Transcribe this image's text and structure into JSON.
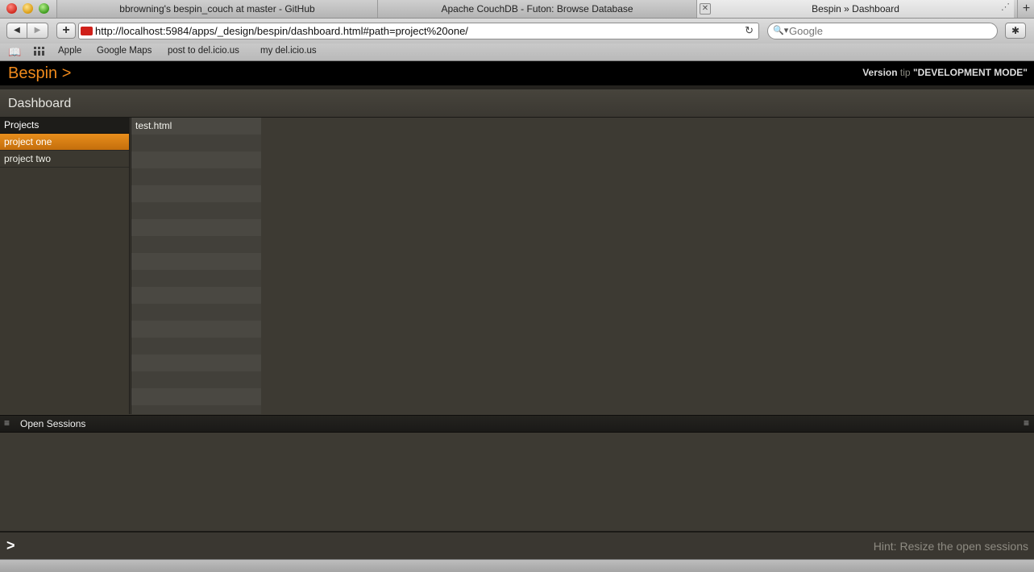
{
  "browser": {
    "tabs": [
      {
        "label": "bbrowning's bespin_couch at master - GitHub"
      },
      {
        "label": "Apache CouchDB - Futon: Browse Database"
      },
      {
        "label": "Bespin » Dashboard"
      }
    ],
    "tab_close_label": "✕",
    "new_tab_label": "+",
    "url": "http://localhost:5984/apps/_design/bespin/dashboard.html#path=project%20one/",
    "search_placeholder": "Google",
    "bookmarks": [
      "Apple",
      "Google Maps",
      "post to del.icio.us",
      "my del.icio.us"
    ]
  },
  "app": {
    "logo": "Bespin >",
    "version_label": "Version",
    "version_tip": "tip",
    "version_mode": "\"DEVELOPMENT MODE\"",
    "page_title": "Dashboard",
    "projects_header": "Projects",
    "projects": [
      "project one",
      "project two"
    ],
    "selected_project": "project one",
    "files": [
      "test.html"
    ],
    "sessions_title": "Open Sessions",
    "prompt": ">",
    "hint": "Hint: Resize the open sessions"
  },
  "colors": {
    "accent": "#f08a1c",
    "selected_bg": "#d97f14",
    "background": "#3d3a33"
  }
}
